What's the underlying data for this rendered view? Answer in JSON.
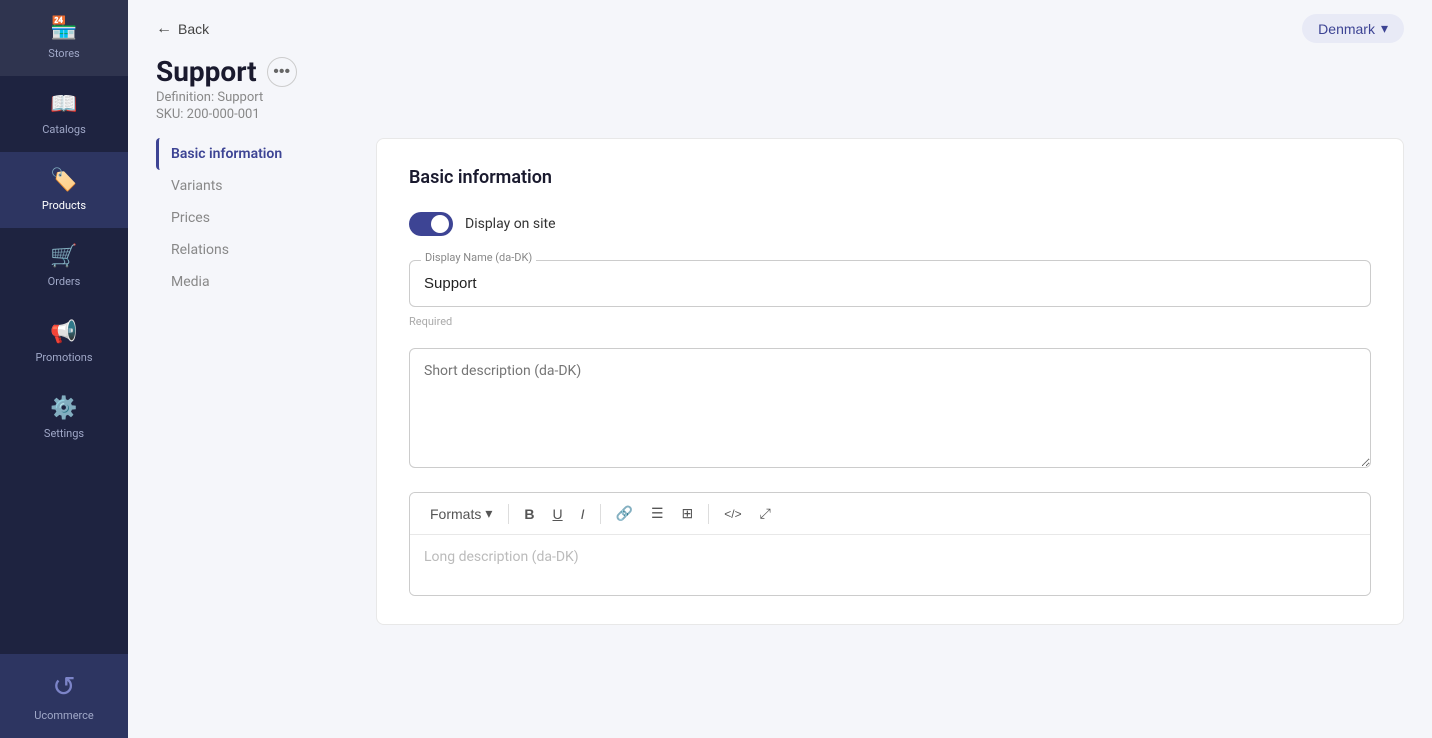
{
  "sidebar": {
    "items": [
      {
        "id": "stores",
        "label": "Stores",
        "icon": "🏪",
        "active": false
      },
      {
        "id": "catalogs",
        "label": "Catalogs",
        "icon": "📖",
        "active": false
      },
      {
        "id": "products",
        "label": "Products",
        "icon": "🏷️",
        "active": true
      },
      {
        "id": "orders",
        "label": "Orders",
        "icon": "🛒",
        "active": false
      },
      {
        "id": "promotions",
        "label": "Promotions",
        "icon": "📢",
        "active": false
      },
      {
        "id": "settings",
        "label": "Settings",
        "icon": "⚙️",
        "active": false
      }
    ],
    "bottom": {
      "label": "Ucommerce",
      "icon": "↺"
    }
  },
  "topbar": {
    "back_label": "Back",
    "locale_label": "Denmark",
    "locale_arrow": "▾"
  },
  "page": {
    "title": "Support",
    "definition": "Definition: Support",
    "sku": "SKU: 200-000-001"
  },
  "left_nav": {
    "items": [
      {
        "id": "basic-information",
        "label": "Basic information",
        "active": true
      },
      {
        "id": "variants",
        "label": "Variants",
        "active": false
      },
      {
        "id": "prices",
        "label": "Prices",
        "active": false
      },
      {
        "id": "relations",
        "label": "Relations",
        "active": false
      },
      {
        "id": "media",
        "label": "Media",
        "active": false
      }
    ]
  },
  "basic_info": {
    "section_title": "Basic information",
    "toggle_label": "Display on site",
    "toggle_on": true,
    "display_name_label": "Display Name (da-DK)",
    "display_name_value": "Support",
    "display_name_hint": "Required",
    "short_desc_placeholder": "Short description (da-DK)",
    "rte_formats_label": "Formats",
    "rte_bold": "B",
    "rte_underline": "U",
    "rte_italic": "I",
    "rte_link": "🔗",
    "rte_list": "≡",
    "rte_table": "⊞",
    "rte_code": "</>",
    "rte_expand": "⤢",
    "long_desc_placeholder": "Long description (da-DK)"
  }
}
